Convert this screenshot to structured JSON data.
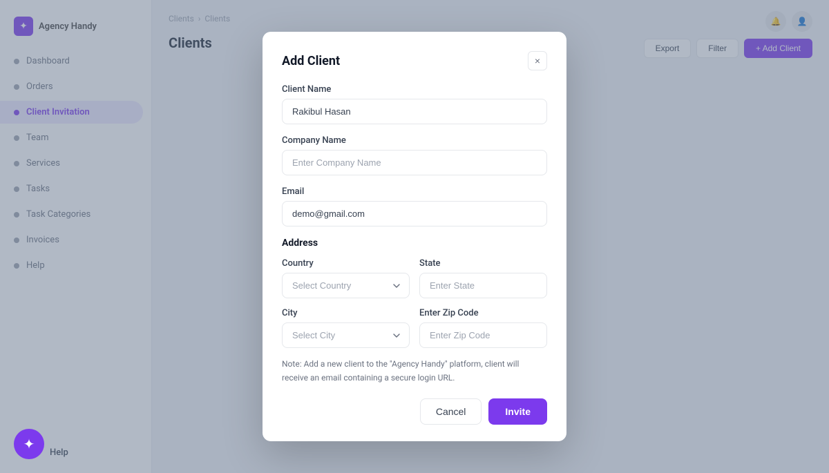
{
  "sidebar": {
    "logo_text": "Agency Handy",
    "items": [
      {
        "label": "Dashboard",
        "active": false
      },
      {
        "label": "Orders",
        "active": false
      },
      {
        "label": "Client Invitation",
        "active": true
      },
      {
        "label": "Team",
        "active": false
      },
      {
        "label": "Services",
        "active": false
      },
      {
        "label": "Tasks",
        "active": false
      },
      {
        "label": "Task Categories",
        "active": false
      },
      {
        "label": "Invoices",
        "active": false
      },
      {
        "label": "Help",
        "active": false
      }
    ]
  },
  "breadcrumb": {
    "items": [
      "Clients",
      "Clients"
    ]
  },
  "page": {
    "title": "Clients"
  },
  "header_buttons": {
    "export": "Export",
    "filter": "Filter",
    "add_client": "+ Add Client"
  },
  "modal": {
    "title": "Add Client",
    "close_label": "×",
    "fields": {
      "client_name_label": "Client Name",
      "client_name_value": "Rakibul Hasan",
      "company_name_label": "Company Name",
      "company_name_placeholder": "Enter Company Name",
      "email_label": "Email",
      "email_value": "demo@gmail.com",
      "address_section": "Address",
      "country_label": "Country",
      "country_placeholder": "Select Country",
      "state_label": "State",
      "state_placeholder": "Enter State",
      "city_label": "City",
      "city_placeholder": "Select City",
      "zip_label": "Enter Zip Code",
      "zip_placeholder": "Enter Zip Code"
    },
    "note": "Note: Add a new client to the \"Agency Handy\" platform, client will receive an email containing a secure login URL.",
    "cancel_label": "Cancel",
    "invite_label": "Invite"
  },
  "bottom": {
    "label": "Help"
  },
  "colors": {
    "primary": "#7c3aed",
    "accent_bg": "#ede9ff"
  }
}
